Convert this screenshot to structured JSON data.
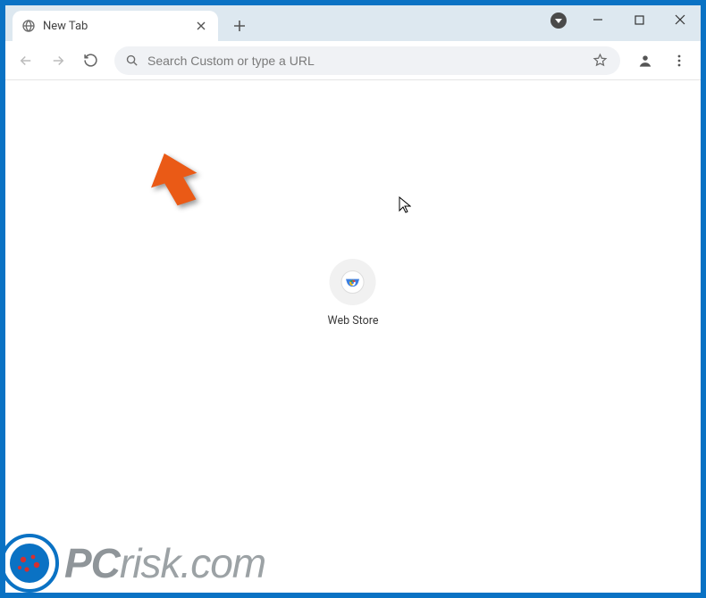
{
  "tab": {
    "title": "New Tab"
  },
  "omnibox": {
    "placeholder": "Search Custom or type a URL"
  },
  "shortcut": {
    "label": "Web Store"
  },
  "watermark": {
    "text_prefix": "PC",
    "text_suffix": "risk.com"
  }
}
